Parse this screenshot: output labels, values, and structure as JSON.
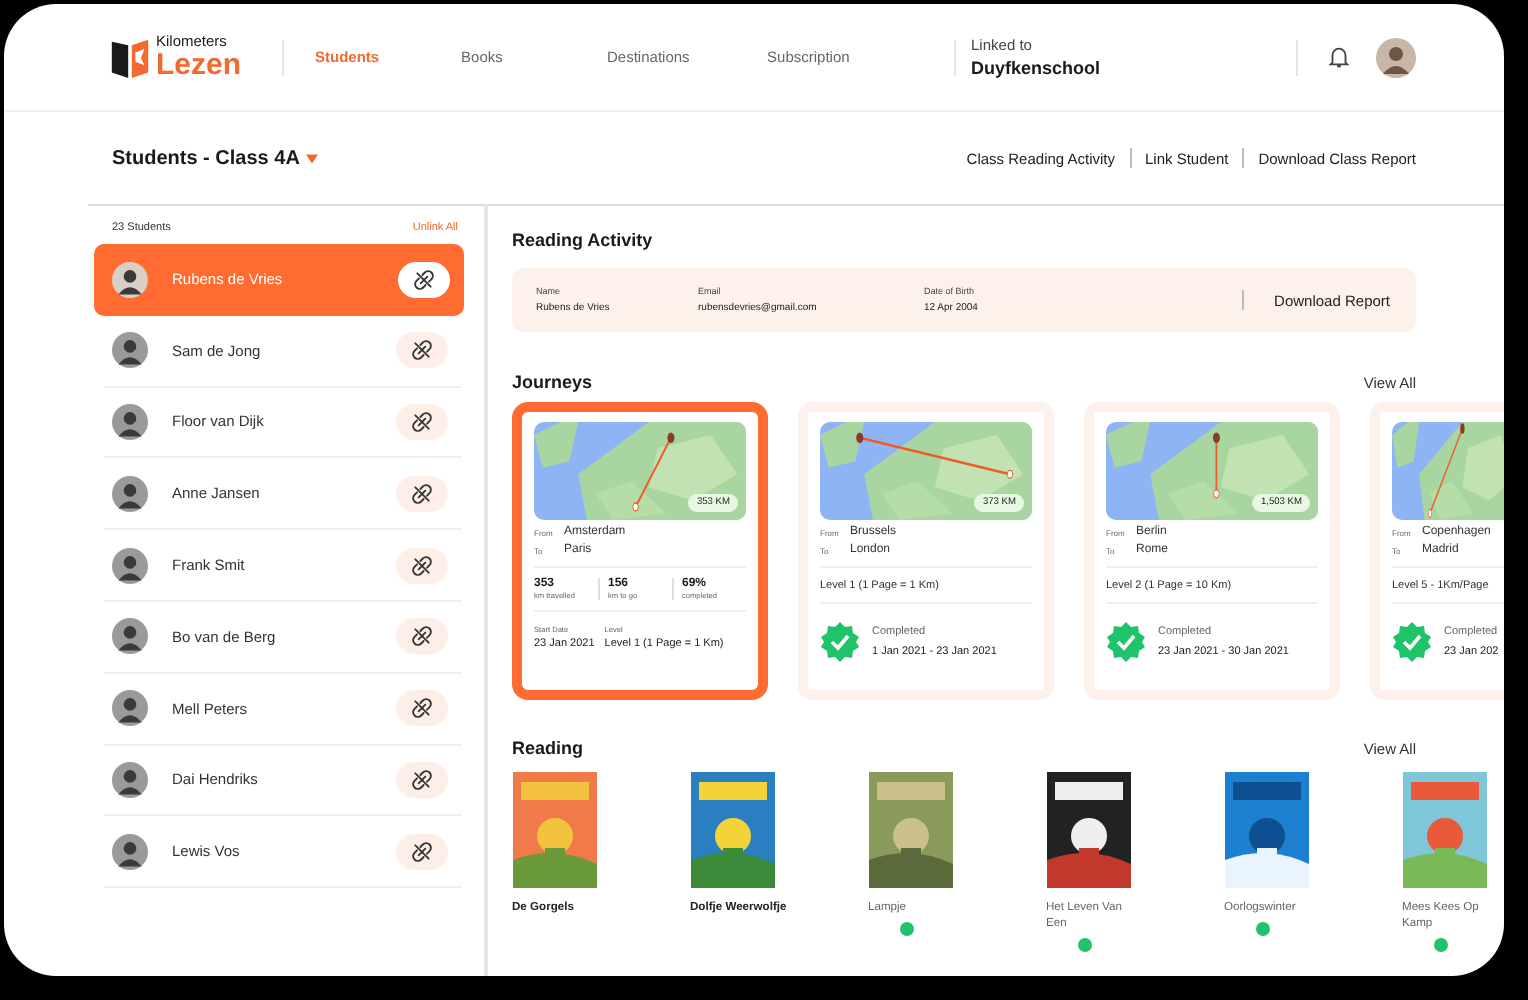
{
  "logo": {
    "top": "Kilometers",
    "bottom": "Lezen"
  },
  "nav": [
    {
      "label": "Students",
      "selected": true
    },
    {
      "label": "Books",
      "selected": false
    },
    {
      "label": "Destinations",
      "selected": false
    },
    {
      "label": "Subscription",
      "selected": false
    }
  ],
  "linked": {
    "label": "Linked to",
    "school": "Duyfkenschool"
  },
  "class_title": "Students - Class 4A",
  "actions": [
    "Class Reading Activity",
    "Link Student",
    "Download Class Report"
  ],
  "sidebar": {
    "count": "23 Students",
    "unlink_all": "Unlink All",
    "students": [
      {
        "name": "Rubens de Vries",
        "selected": true
      },
      {
        "name": "Sam de Jong",
        "selected": false
      },
      {
        "name": "Floor van Dijk",
        "selected": false
      },
      {
        "name": "Anne Jansen",
        "selected": false
      },
      {
        "name": "Frank Smit",
        "selected": false
      },
      {
        "name": "Bo van de Berg",
        "selected": false
      },
      {
        "name": "Mell Peters",
        "selected": false
      },
      {
        "name": "Dai Hendriks",
        "selected": false
      },
      {
        "name": "Lewis Vos",
        "selected": false
      }
    ]
  },
  "activity": {
    "title": "Reading Activity",
    "fields": [
      {
        "label": "Name",
        "value": "Rubens de Vries"
      },
      {
        "label": "Email",
        "value": "rubensdevries@gmail.com"
      },
      {
        "label": "Date of Birth",
        "value": "12 Apr 2004"
      }
    ],
    "download": "Download Report"
  },
  "journeys": {
    "title": "Journeys",
    "view_all": "View All",
    "cards": [
      {
        "kind": "active",
        "selected": true,
        "distance": "353 KM",
        "from_label": "From",
        "from": "Amsterdam",
        "to_label": "To",
        "to": "Paris",
        "stats": [
          {
            "value": "353",
            "label": "km travelled"
          },
          {
            "value": "156",
            "label": "km to go"
          },
          {
            "value": "69%",
            "label": "completed"
          }
        ],
        "start_label": "Start Date",
        "start": "23 Jan 2021",
        "level_label": "Level",
        "level_text": "Level 1 (1 Page = 1 Km)"
      },
      {
        "kind": "completed",
        "selected": false,
        "distance": "373 KM",
        "from_label": "From",
        "from": "Brussels",
        "to_label": "To",
        "to": "London",
        "level_text": "Level 1 (1 Page = 1 Km)",
        "status": "Completed",
        "dates": "1 Jan 2021 - 23 Jan 2021"
      },
      {
        "kind": "completed",
        "selected": false,
        "distance": "1,503 KM",
        "from_label": "From",
        "from": "Berlin",
        "to_label": "To",
        "to": "Rome",
        "level_text": "Level 2 (1 Page = 10 Km)",
        "status": "Completed",
        "dates": "23 Jan 2021 - 30 Jan 2021"
      },
      {
        "kind": "completed",
        "selected": false,
        "from_label": "From",
        "from": "Copenhagen",
        "to_label": "To",
        "to": "Madrid",
        "level_text": "Level 5 - 1Km/Page",
        "status": "Completed",
        "dates": "23 Jan 202"
      }
    ]
  },
  "reading": {
    "title": "Reading",
    "view_all": "View All",
    "books": [
      {
        "title": "De Gorgels",
        "finished": true
      },
      {
        "title": "Dolfje Weerwolfje",
        "finished": true
      },
      {
        "title": "Lampje",
        "finished": false
      },
      {
        "title": "Het Leven Van Een",
        "finished": false
      },
      {
        "title": "Oorlogswinter",
        "finished": false
      },
      {
        "title": "Mees Kees Op Kamp",
        "finished": false
      }
    ]
  }
}
